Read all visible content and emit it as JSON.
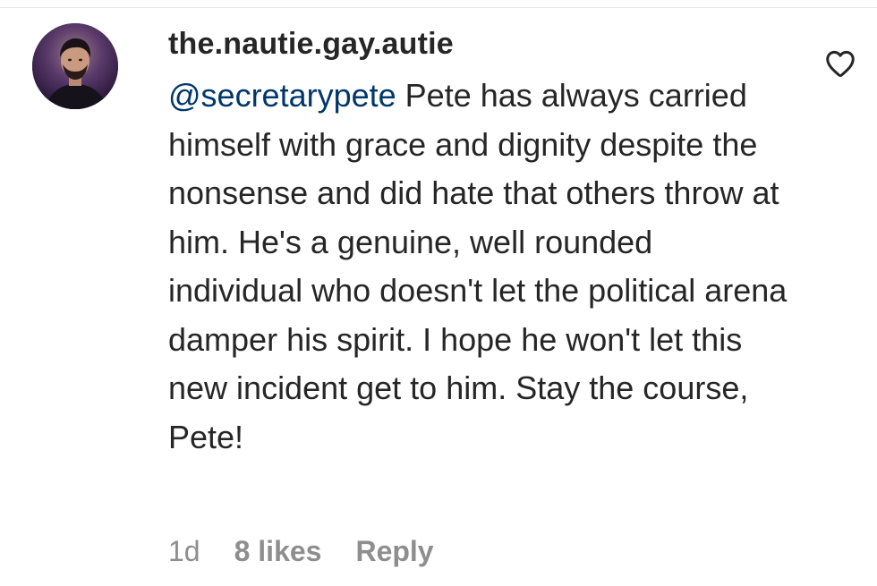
{
  "comment": {
    "username": "the.nautie.gay.autie",
    "mention": "@secretarypete",
    "text": " Pete has always carried himself with grace and dignity despite the nonsense and did hate that others throw at him. He's a genuine, well rounded individual who doesn't let the political arena damper his spirit. I hope he won't let this new incident get to him. Stay the course, Pete!",
    "time": "1d",
    "likes": "8 likes",
    "reply_label": "Reply"
  },
  "icons": {
    "like": "heart-icon",
    "avatar": "avatar"
  },
  "colors": {
    "text": "#262626",
    "mention": "#00376b",
    "meta": "#8e8e8e"
  }
}
